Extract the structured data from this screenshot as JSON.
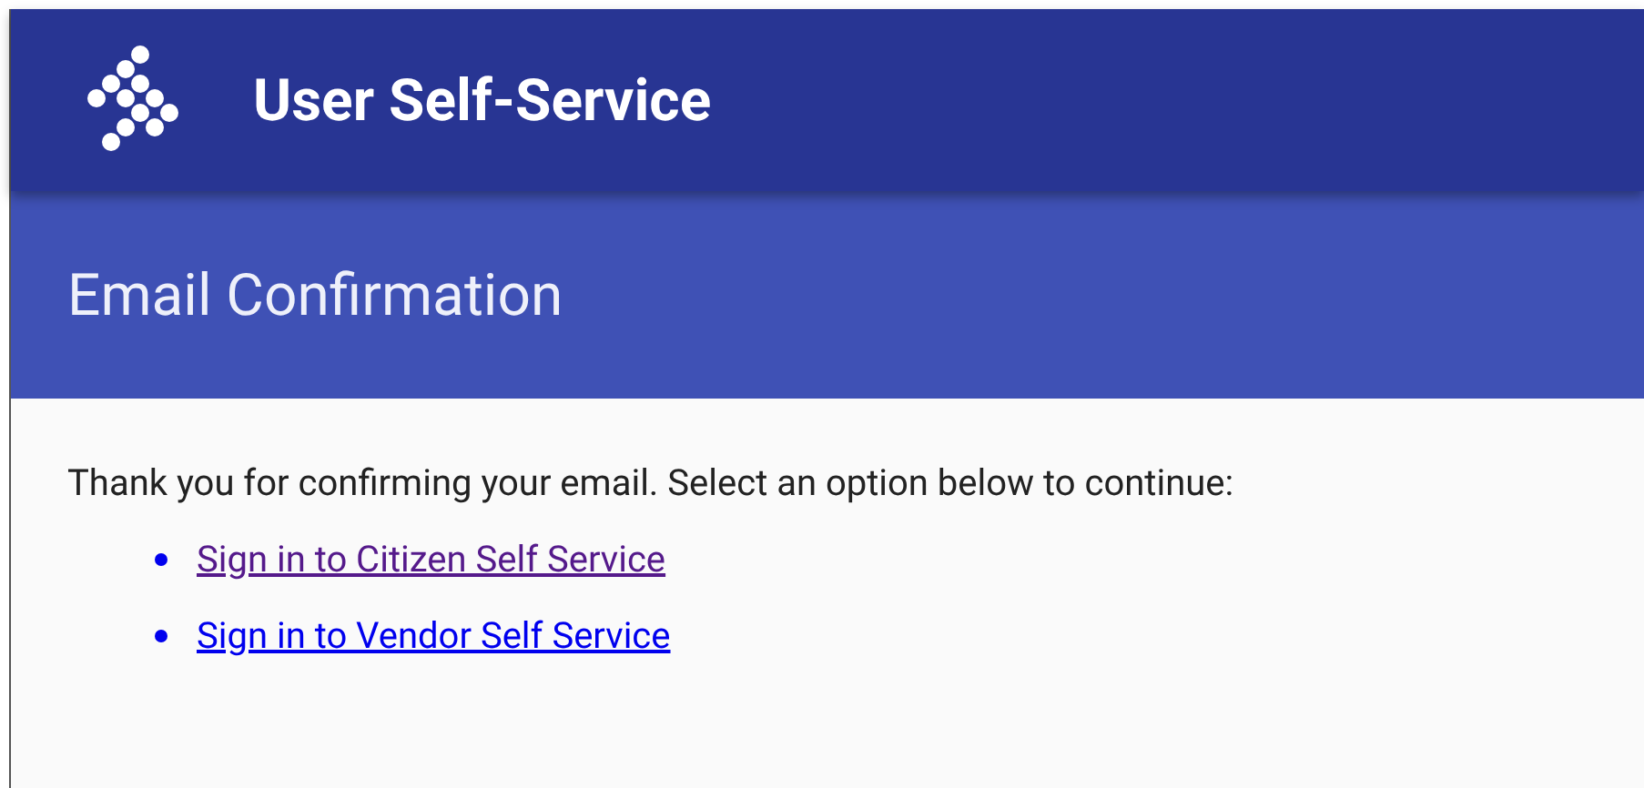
{
  "app_bar": {
    "title": "User Self-Service"
  },
  "page_header": {
    "title": "Email Confirmation"
  },
  "content": {
    "message": "Thank you for confirming your email. Select an option below to continue:",
    "links": [
      {
        "label": "Sign in to Citizen Self Service",
        "visited": true
      },
      {
        "label": "Sign in to Vendor Self Service",
        "visited": false
      }
    ]
  }
}
